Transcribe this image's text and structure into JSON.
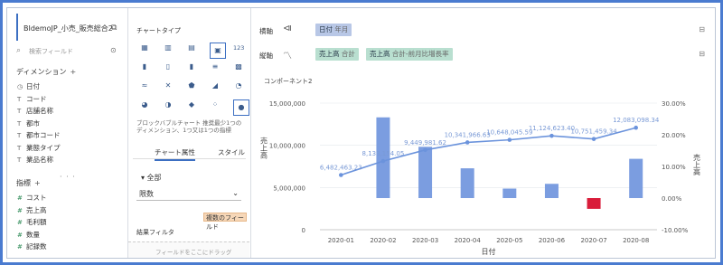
{
  "left": {
    "title": "BIdemoJP_小売_販売総合2",
    "search_placeholder": "検索フィールド",
    "dim_header": "ディメンション",
    "dimensions": [
      {
        "icon": "clock-icon",
        "glyph": "🕒",
        "label": "日付"
      },
      {
        "icon": "text-icon",
        "glyph": "T",
        "label": "コード"
      },
      {
        "icon": "text-icon",
        "glyph": "T",
        "label": "店舗名称"
      },
      {
        "icon": "text-icon",
        "glyph": "T",
        "label": "都市"
      },
      {
        "icon": "text-icon",
        "glyph": "T",
        "label": "都市コード"
      },
      {
        "icon": "text-icon",
        "glyph": "T",
        "label": "業態タイプ"
      },
      {
        "icon": "text-icon",
        "glyph": "T",
        "label": "業品名称"
      }
    ],
    "meas_header": "指標",
    "measures": [
      {
        "glyph": "#",
        "label": "コスト"
      },
      {
        "glyph": "#",
        "label": "売上高"
      },
      {
        "glyph": "#",
        "label": "毛利額"
      },
      {
        "glyph": "#",
        "label": "数量"
      },
      {
        "glyph": "#",
        "label": "記録数"
      }
    ]
  },
  "mid": {
    "chart_type_header": "チャートタイプ",
    "description": "ブロックバブルチャート 推奨最少1つのディメンション、1つ又は1つの指標",
    "tabs": [
      "チャート属性",
      "スタイル"
    ],
    "all_label": "▾ 全部",
    "dropdown_value": "限数",
    "tag_label": "複数のフィールド",
    "filter_label": "結果フィルタ",
    "drop_placeholder": "フィールドをここにドラッグ"
  },
  "shelves": {
    "x_label": "横軸",
    "x_pill": "日付",
    "x_pill_sub": "年月",
    "y_label": "縦軸",
    "y_pill1": "売上高",
    "y_pill1_sub": "合計",
    "y_pill2": "売上高",
    "y_pill2_sub": "合計-前月比増長率"
  },
  "chart_title": "コンポーネント2",
  "chart_data": {
    "type": "bar",
    "categories": [
      "2020-01",
      "2020-02",
      "2020-03",
      "2020-04",
      "2020-05",
      "2020-06",
      "2020-07",
      "2020-08"
    ],
    "line_values": [
      6482463.23,
      8133154.05,
      9449981.62,
      10341966.63,
      10648045.59,
      11124623.4,
      10751459.34,
      12083098.34
    ],
    "line_labels": [
      "6,482,463.23",
      "8,133,154.05",
      "9,449,981.62",
      "10,341,966.63",
      "10,648,045.59",
      "11,124,623.40",
      "10,751,459.34",
      "12,083,098.34"
    ],
    "bar_values": [
      null,
      25.5,
      16.2,
      9.4,
      3.0,
      4.5,
      -3.4,
      12.4
    ],
    "xlabel": "日付",
    "ylabel_left": "売上高",
    "ylabel_right": "売上高",
    "left_ticks": [
      "0",
      "5,000,000",
      "10,000,000",
      "15,000,000"
    ],
    "right_ticks": [
      "-10.00%",
      "0.00%",
      "10.00%",
      "20.00%",
      "30.00%"
    ],
    "ylim_left": [
      0,
      15000000
    ],
    "ylim_right": [
      -10,
      30
    ],
    "colors": {
      "bar_pos": "#7b9de0",
      "bar_neg": "#d91c3a",
      "line": "#6b93dc",
      "label": "#7a9ad6"
    }
  }
}
